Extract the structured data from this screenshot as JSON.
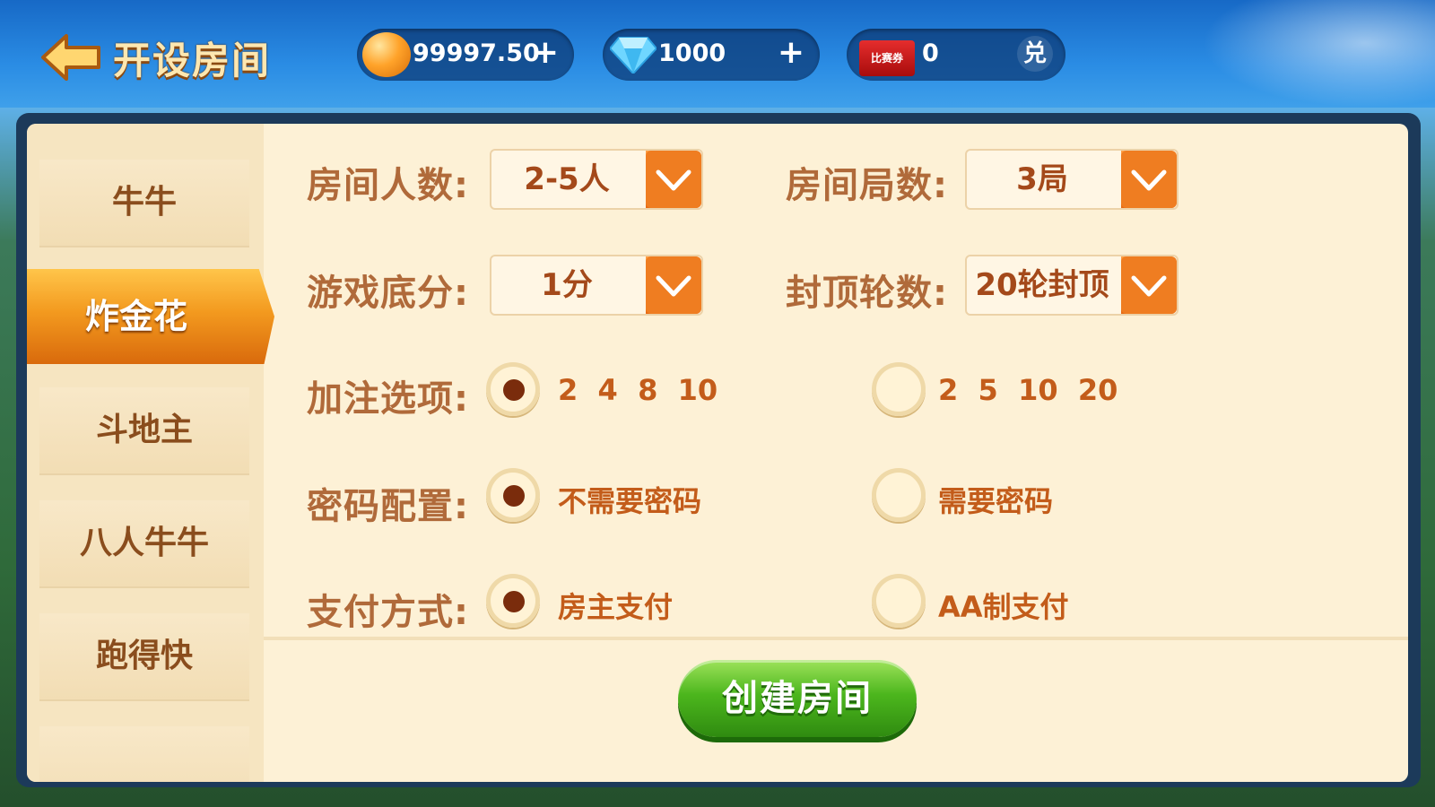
{
  "header": {
    "title": "开设房间",
    "coins": "99997.50",
    "diamonds": "1000",
    "ticket_label": "比赛券",
    "tickets": "0",
    "exchange": "兑",
    "plus": "+"
  },
  "sidebar": {
    "items": [
      {
        "label": "牛牛"
      },
      {
        "label": "炸金花"
      },
      {
        "label": "斗地主"
      },
      {
        "label": "八人牛牛"
      },
      {
        "label": "跑得快"
      }
    ],
    "active_index": 1
  },
  "settings": {
    "players_label": "房间人数:",
    "players_value": "2-5人",
    "rounds_label": "房间局数:",
    "rounds_value": "3局",
    "base_label": "游戏底分:",
    "base_value": "1分",
    "cap_label": "封顶轮数:",
    "cap_value": "20轮封顶",
    "bet_label": "加注选项:",
    "bet_option_1": "2  4  8  10",
    "bet_option_2": "2  5  10  20",
    "password_label": "密码配置:",
    "password_option_1": "不需要密码",
    "password_option_2": "需要密码",
    "pay_label": "支付方式:",
    "pay_option_1": "房主支付",
    "pay_option_2": "AA制支付"
  },
  "actions": {
    "create_label": "创建房间"
  }
}
